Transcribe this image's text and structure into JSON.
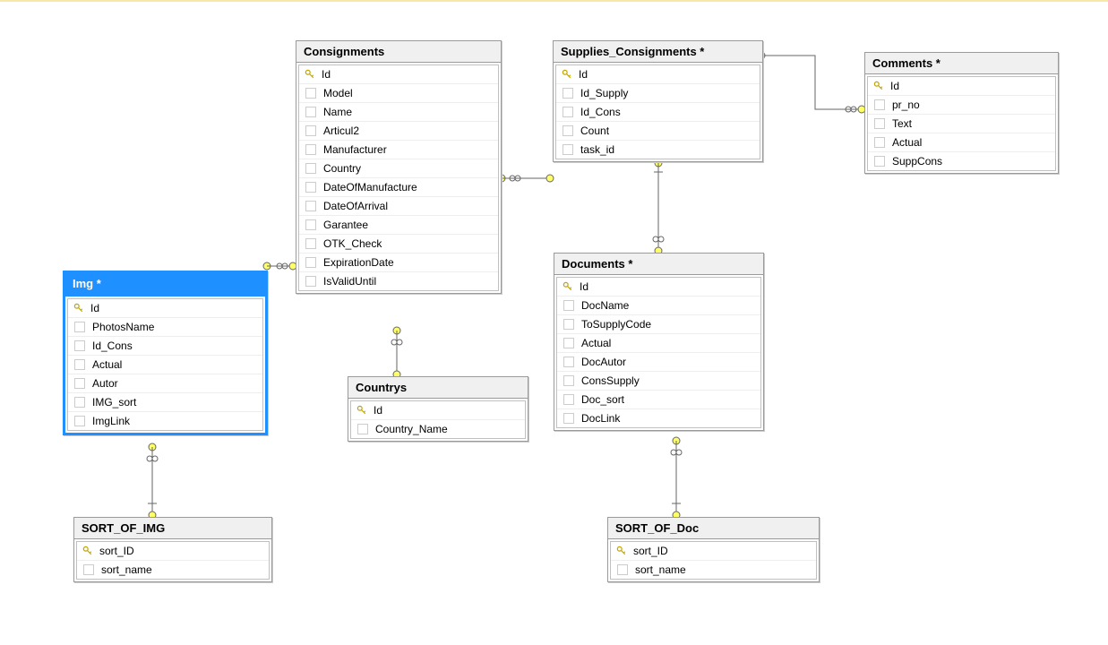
{
  "tables": {
    "consignments": {
      "title": "Consignments",
      "cols": [
        "Id",
        "Model",
        "Name",
        "Articul2",
        "Manufacturer",
        "Country",
        "DateOfManufacture",
        "DateOfArrival",
        "Garantee",
        "OTK_Check",
        "ExpirationDate",
        "IsValidUntil"
      ],
      "pk": [
        0
      ]
    },
    "supplies_consignments": {
      "title": "Supplies_Consignments *",
      "cols": [
        "Id",
        "Id_Supply",
        "Id_Cons",
        "Count",
        "task_id"
      ],
      "pk": [
        0
      ]
    },
    "comments": {
      "title": "Comments *",
      "cols": [
        "Id",
        "pr_no",
        "Text",
        "Actual",
        "SuppCons"
      ],
      "pk": [
        0
      ]
    },
    "img": {
      "title": "Img *",
      "cols": [
        "Id",
        "PhotosName",
        "Id_Cons",
        "Actual",
        "Autor",
        "IMG_sort",
        "ImgLink"
      ],
      "pk": [
        0
      ]
    },
    "countrys": {
      "title": "Countrys",
      "cols": [
        "Id",
        "Country_Name"
      ],
      "pk": [
        0
      ]
    },
    "documents": {
      "title": "Documents *",
      "cols": [
        "Id",
        "DocName",
        "ToSupplyCode",
        "Actual",
        "DocAutor",
        "ConsSupply",
        "Doc_sort",
        "DocLink"
      ],
      "pk": [
        0
      ]
    },
    "sort_of_img": {
      "title": "SORT_OF_IMG",
      "cols": [
        "sort_ID",
        "sort_name"
      ],
      "pk": [
        0
      ]
    },
    "sort_of_doc": {
      "title": "SORT_OF_Doc",
      "cols": [
        "sort_ID",
        "sort_name"
      ],
      "pk": [
        0
      ]
    }
  }
}
